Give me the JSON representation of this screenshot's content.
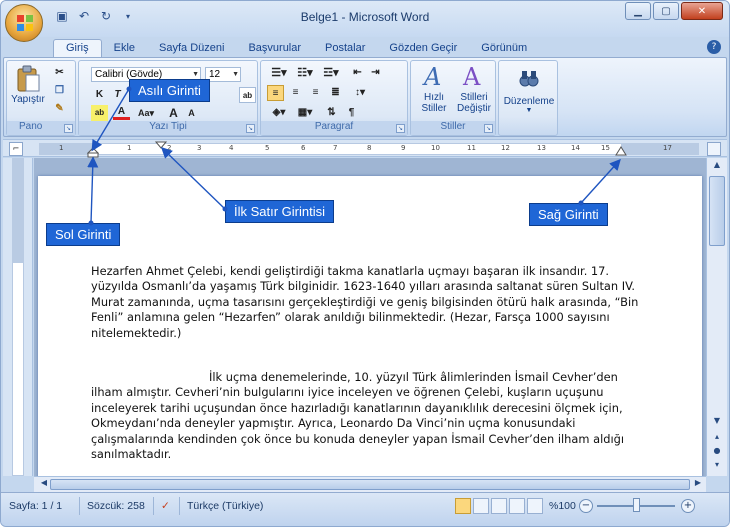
{
  "window": {
    "title": "Belge1 - Microsoft Word"
  },
  "quick_access": {
    "save_icon": "save-icon",
    "undo_icon": "undo-icon",
    "redo_icon": "redo-icon"
  },
  "tabs": [
    {
      "label": "Giriş",
      "active": true
    },
    {
      "label": "Ekle"
    },
    {
      "label": "Sayfa Düzeni"
    },
    {
      "label": "Başvurular"
    },
    {
      "label": "Postalar"
    },
    {
      "label": "Gözden Geçir"
    },
    {
      "label": "Görünüm"
    }
  ],
  "ribbon": {
    "clipboard": {
      "label": "Pano",
      "paste_label": "Yapıştır"
    },
    "font": {
      "label": "Yazı Tipi",
      "font_name": "Calibri (Gövde)",
      "font_size": "12"
    },
    "paragraph": {
      "label": "Paragraf"
    },
    "styles": {
      "label": "Stiller",
      "quick_styles": "Hızlı",
      "quick_styles_2": "Stiller",
      "change_styles": "Stilleri",
      "change_styles_2": "Değiştir"
    },
    "editing": {
      "label": "Düzenleme"
    }
  },
  "ruler": {
    "numbers": [
      "1",
      "1",
      "2",
      "3",
      "4",
      "5",
      "6",
      "7",
      "8",
      "9",
      "10",
      "11",
      "12",
      "13",
      "14",
      "15",
      "17"
    ]
  },
  "annotations": {
    "hanging_indent": "Asılı Girinti",
    "left_indent": "Sol Girinti",
    "first_line_indent": "İlk Satır Girintisi",
    "right_indent": "Sağ Girinti"
  },
  "document": {
    "paragraphs": [
      "Hezarfen Ahmet Çelebi, kendi geliştirdiği takma kanatlarla uçmayı başaran ilk insandır. 17. yüzyılda Osmanlı’da yaşamış Türk bilginidir. 1623-1640 yılları arasında saltanat süren Sultan IV. Murat zamanında, uçma tasarısını gerçekleştirdiği ve geniş bilgisinden ötürü halk arasında, “Bin Fenli” anlamına gelen “Hezarfen” olarak anıldığı bilinmektedir. (Hezar, Farsça 1000 sayısını nitelemektedir.)",
      "İlk uçma denemelerinde, 10. yüzyıl Türk âlimlerinden İsmail Cevher’den ilham almıştır. Cevheri’nin bulgularını iyice inceleyen ve öğrenen Çelebi, kuşların uçuşunu inceleyerek tarihi uçuşundan önce hazırladığı kanatlarının dayanıklılık derecesini ölçmek için, Okmeydanı’nda deneyler yapmıştır. Ayrıca, Leonardo Da Vinci’nin uçma konusundaki çalışmalarında kendinden çok önce bu konuda deneyler yapan İsmail Cevher’den ilham aldığı sanılmaktadır."
    ]
  },
  "statusbar": {
    "page": "Sayfa: 1 / 1",
    "words": "Sözcük: 258",
    "language": "Türkçe (Türkiye)",
    "zoom": "%100"
  },
  "colors": {
    "accent": "#1f66d6",
    "ribbon_text": "#15428b"
  }
}
